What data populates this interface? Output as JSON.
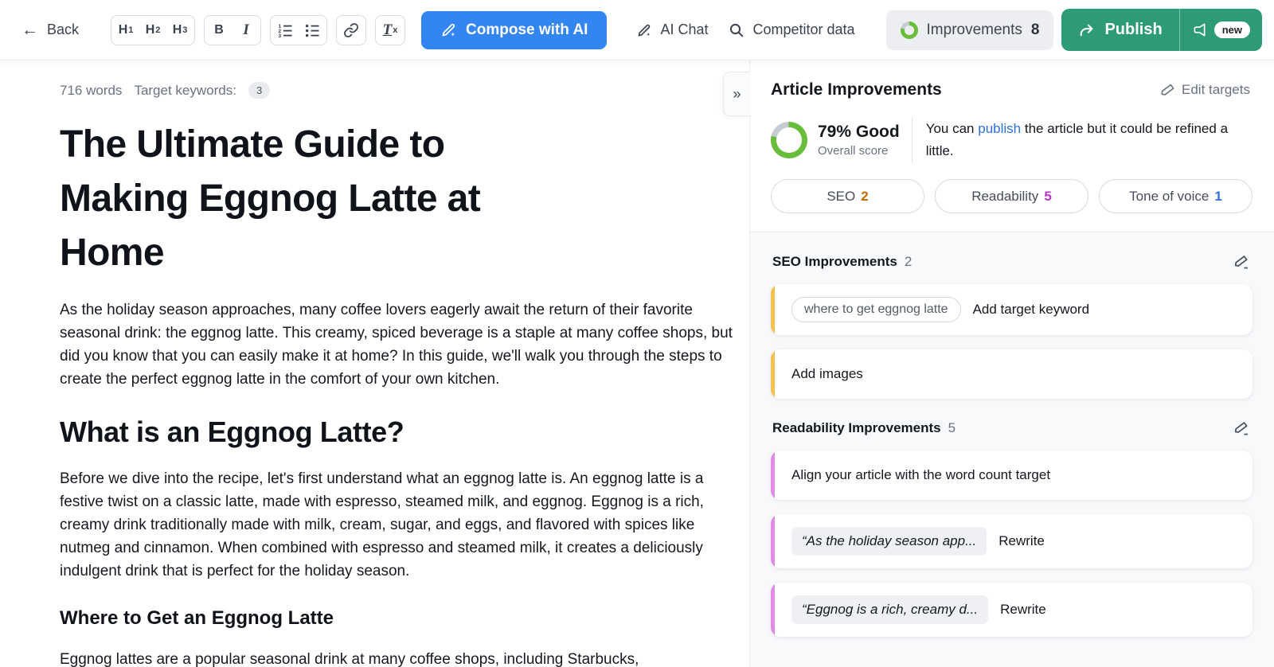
{
  "toolbar": {
    "back_label": "Back",
    "heading_buttons": [
      {
        "label": "H",
        "sub": "1"
      },
      {
        "label": "H",
        "sub": "2"
      },
      {
        "label": "H",
        "sub": "3"
      }
    ],
    "bold_label": "B",
    "italic_label": "I",
    "clear_format_label": "T",
    "clear_format_sub": "x",
    "compose_label": "Compose with AI",
    "ai_chat_label": "AI Chat",
    "competitor_label": "Competitor data",
    "improvements_label": "Improvements",
    "improvements_count": "8",
    "publish_label": "Publish",
    "new_badge_label": "new"
  },
  "editor": {
    "word_count": "716 words",
    "keywords_label": "Target keywords:",
    "keywords_count": "3",
    "title": "The Ultimate Guide to Making Eggnog Latte at Home",
    "paragraph_1": "As the holiday season approaches, many coffee lovers eagerly await the return of their favorite seasonal drink: the eggnog latte. This creamy, spiced beverage is a staple at many coffee shops, but did you know that you can easily make it at home? In this guide, we'll walk you through the steps to create the perfect eggnog latte in the comfort of your own kitchen.",
    "heading_2": "What is an Eggnog Latte?",
    "paragraph_2": "Before we dive into the recipe, let's first understand what an eggnog latte is. An eggnog latte is a festive twist on a classic latte, made with espresso, steamed milk, and eggnog. Eggnog is a rich, creamy drink traditionally made with milk, cream, sugar, and eggs, and flavored with spices like nutmeg and cinnamon. When combined with espresso and steamed milk, it creates a deliciously indulgent drink that is perfect for the holiday season.",
    "heading_3": "Where to Get an Eggnog Latte",
    "paragraph_3": "Eggnog lattes are a popular seasonal drink at many coffee shops, including Starbucks,"
  },
  "panel": {
    "collapse_glyph": "»",
    "title": "Article Improvements",
    "edit_targets_label": "Edit targets",
    "score": {
      "value": "79% Good",
      "label": "Overall score",
      "percent": 79,
      "message_before": "You can",
      "message_link": "publish",
      "message_after": "the article but it could be refined a little."
    },
    "pills": [
      {
        "label": "SEO",
        "count": "2"
      },
      {
        "label": "Readability",
        "count": "5"
      },
      {
        "label": "Tone of voice",
        "count": "1"
      }
    ],
    "seo_section": {
      "title": "SEO Improvements",
      "count": "2",
      "card_keyword_chip": "where to get eggnog latte",
      "card_keyword_label": "Add target keyword",
      "card_images_label": "Add images"
    },
    "readability_section": {
      "title": "Readability Improvements",
      "count": "5",
      "card_wordcount_label": "Align your article with the word count target",
      "card_rewrite_1_quote": "“As the holiday season app...",
      "card_rewrite_1_action": "Rewrite",
      "card_rewrite_2_quote": "“Eggnog is a rich, creamy d...",
      "card_rewrite_2_action": "Rewrite"
    }
  },
  "colors": {
    "primary_blue": "#3385f2",
    "link_blue": "#2b6fe0",
    "publish_green": "#2e9b77",
    "score_green": "#68bd3b",
    "seo_accent_yellow": "#f2c14e",
    "readability_accent_pink": "#e18ae6",
    "seo_count_orange": "#c06c00",
    "readability_count_purple": "#bb35cf",
    "tone_count_blue": "#2c72dd"
  }
}
